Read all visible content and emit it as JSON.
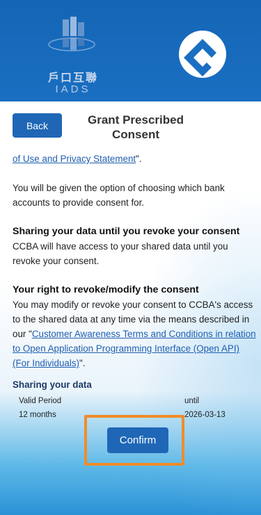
{
  "header": {
    "iads_chinese": "戶口互聯",
    "iads_english": "IADS"
  },
  "page": {
    "back_label": "Back",
    "title": "Grant Prescribed Consent"
  },
  "body": {
    "link_terms_tail": "of Use and Privacy Statement",
    "terms_tail_suffix": "\".",
    "option_text": "You will be given the option of choosing which bank accounts to provide consent for.",
    "sharing_heading": "Sharing your data until you revoke your consent",
    "sharing_text": "CCBA will have access to your shared data until you revoke your consent.",
    "revoke_heading": "Your right to revoke/modify the consent",
    "revoke_text_prefix": "You may modify or revoke your consent to CCBA's access to the shared data at any time via the means described in our \"",
    "revoke_link": "Customer Awareness Terms and Conditions in relation to Open Application Programming Interface (Open API) (For Individuals)",
    "revoke_text_suffix": "\"."
  },
  "sharing": {
    "heading": "Sharing your data",
    "valid_period_label": "Valid Period",
    "valid_period_value": "12 months",
    "until_label": "until",
    "until_value": "2026-03-13"
  },
  "confirm_label": "Confirm",
  "colors": {
    "header_blue": "#1a6fc2",
    "button_blue": "#1f67b6",
    "highlight_orange": "#f08c2a",
    "link_blue": "#1f5fb0"
  }
}
